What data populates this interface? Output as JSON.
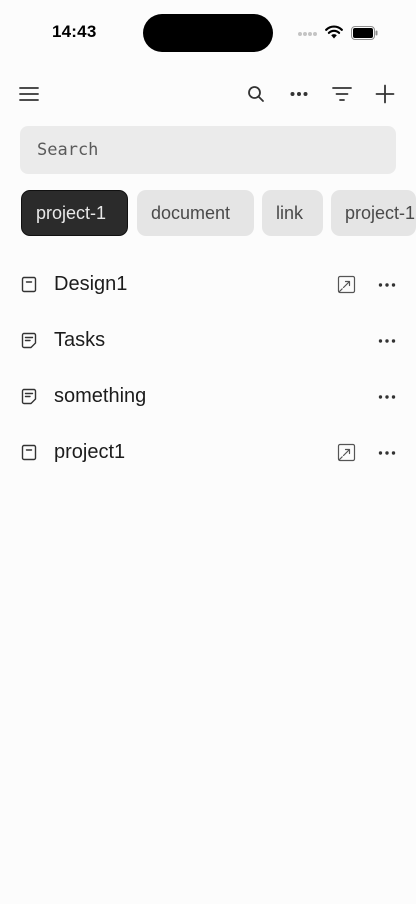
{
  "status_bar": {
    "time": "14:43"
  },
  "toolbar": {
    "menu_icon": "menu-icon",
    "search_icon": "search-icon",
    "more_icon": "more-icon",
    "filter_icon": "filter-icon",
    "add_icon": "plus-icon"
  },
  "search": {
    "placeholder": "Search",
    "value": ""
  },
  "chips": [
    {
      "label": "project-1",
      "active": true
    },
    {
      "label": "document",
      "active": false
    },
    {
      "label": "link",
      "active": false
    },
    {
      "label": "project-1",
      "active": false
    }
  ],
  "list": [
    {
      "title": "Design1",
      "icon": "board-icon",
      "has_link": true
    },
    {
      "title": "Tasks",
      "icon": "note-icon",
      "has_link": false
    },
    {
      "title": "something",
      "icon": "note-icon",
      "has_link": false
    },
    {
      "title": "project1",
      "icon": "board-icon",
      "has_link": true
    }
  ],
  "colors": {
    "background": "#fcfcfc",
    "chip_active_bg": "#2b2b2b",
    "chip_bg": "#e5e5e5",
    "search_bg": "#ebebeb"
  }
}
